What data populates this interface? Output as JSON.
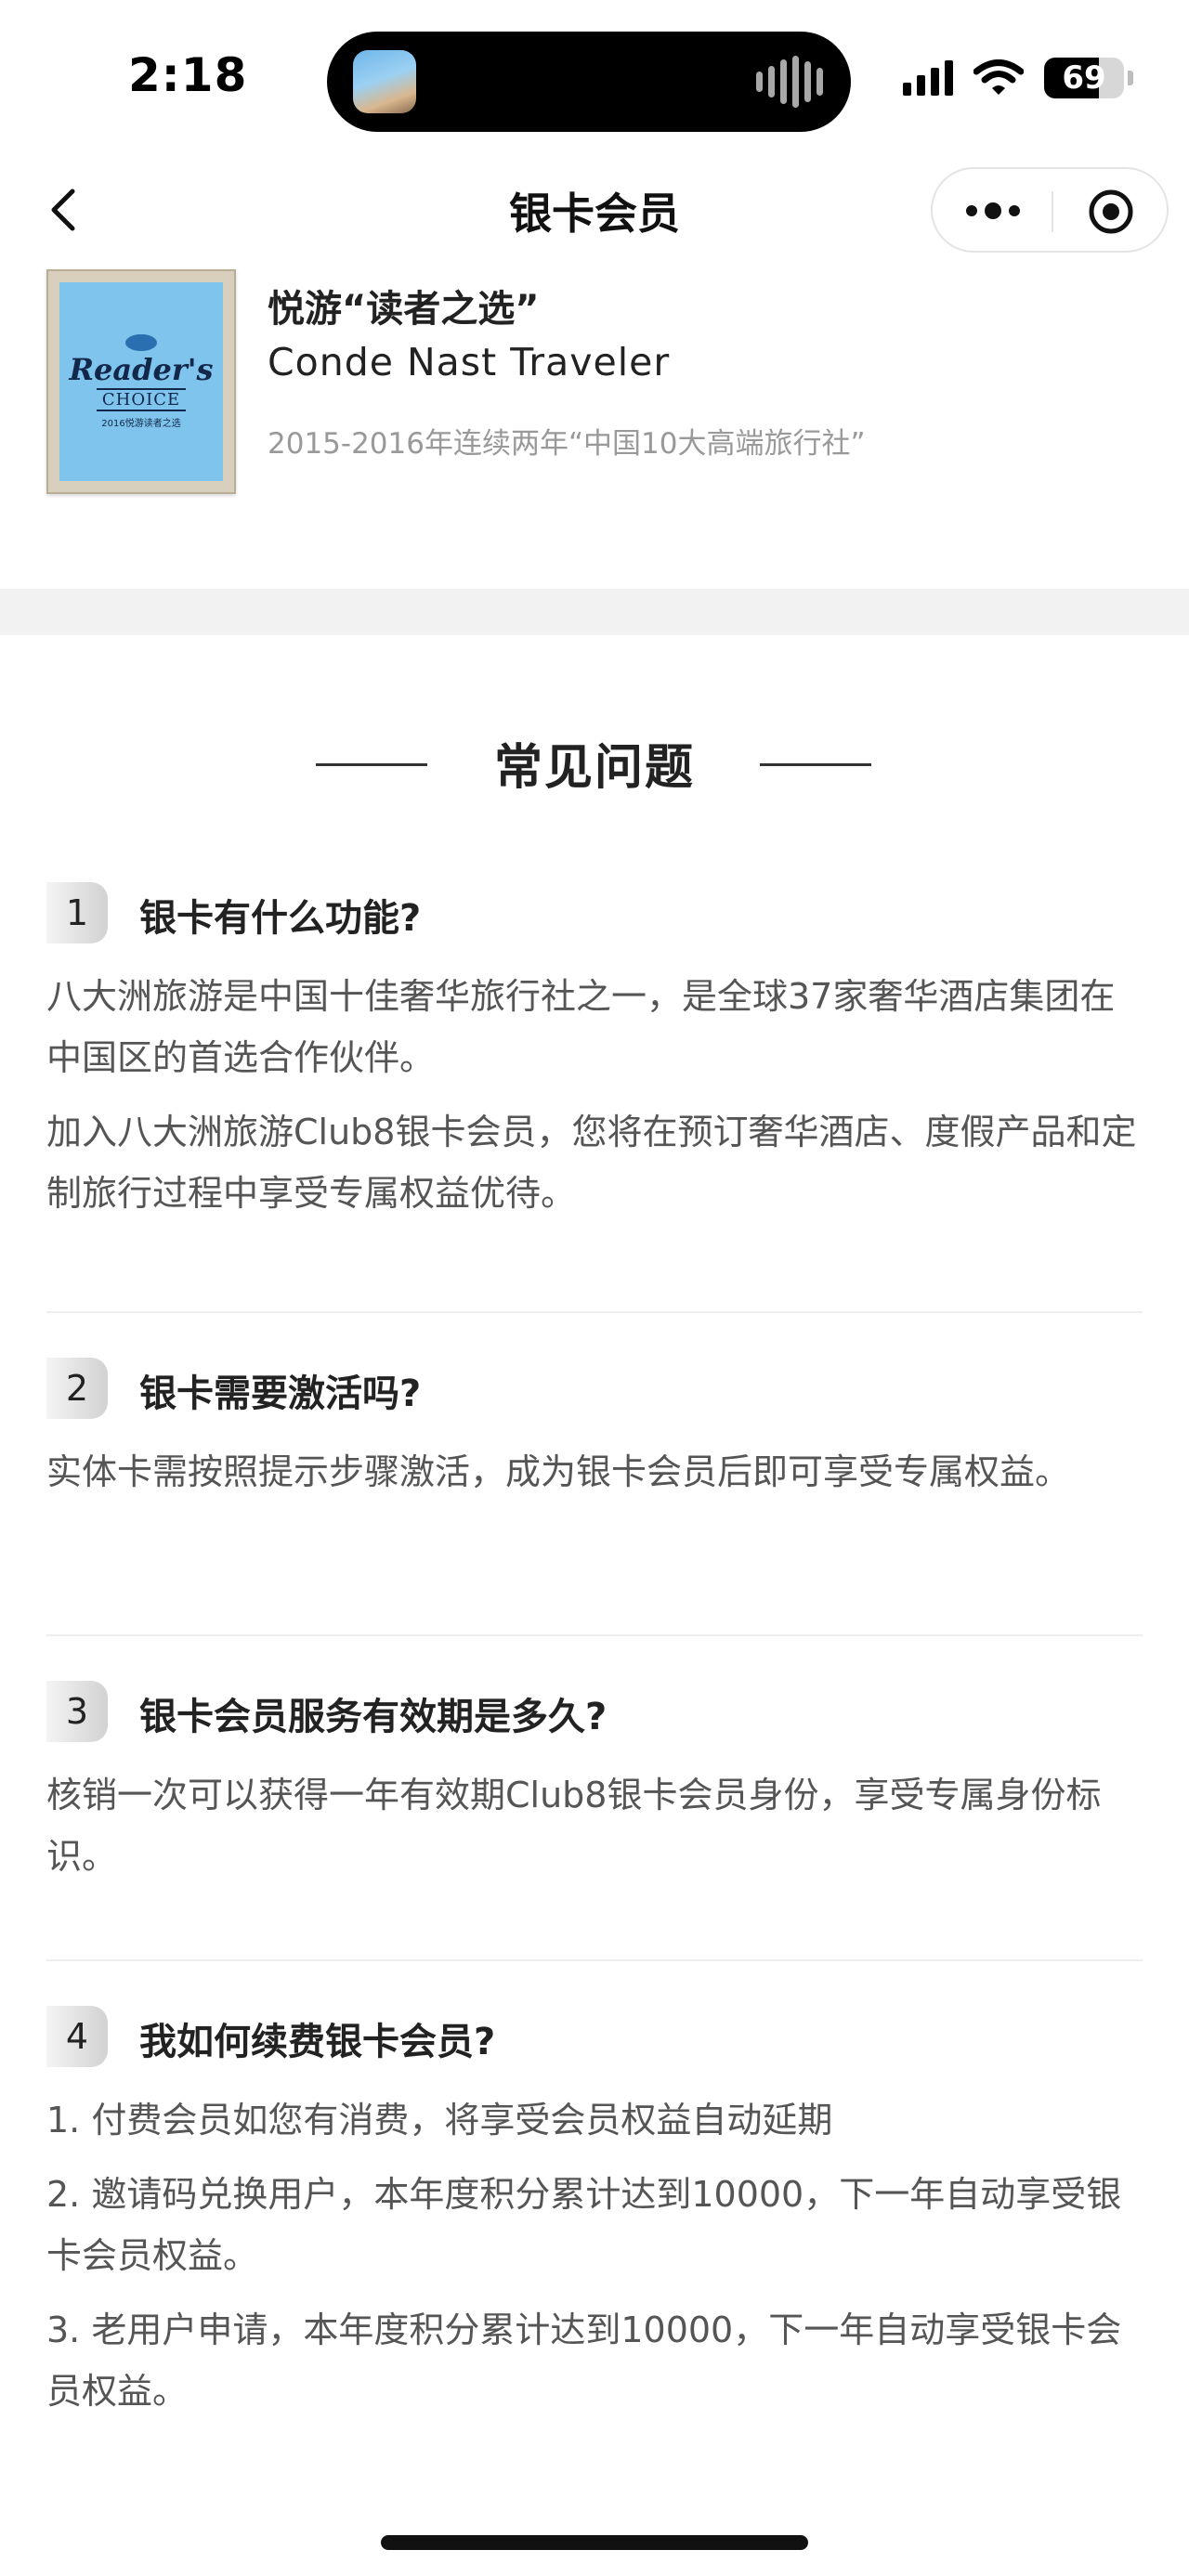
{
  "status_bar": {
    "time": "2:18",
    "battery_level": "69",
    "battery_fraction": 0.69
  },
  "nav": {
    "title": "银卡会员",
    "back_icon": "chevron-left-icon",
    "more_icon": "more-dots-icon",
    "close_icon": "target-circle-icon"
  },
  "award": {
    "title": "悦游“读者之选”",
    "publisher": "Conde Nast Traveler",
    "description": "2015-2016年连续两年“中国10大高端旅行社”",
    "plaque": {
      "main": "Reader's",
      "choice": "CHOICE",
      "sub": "2016悦游读者之选"
    }
  },
  "faq": {
    "title": "常见问题",
    "items": [
      {
        "number": "1",
        "question": "银卡有什么功能?",
        "answers": [
          "八大洲旅游是中国十佳奢华旅行社之一，是全球37家奢华酒店集团在中国区的首选合作伙伴。",
          "加入八大洲旅游Club8银卡会员，您将在预订奢华酒店、度假产品和定制旅行过程中享受专属权益优待。"
        ]
      },
      {
        "number": "2",
        "question": "银卡需要激活吗?",
        "answers": [
          "实体卡需按照提示步骤激活，成为银卡会员后即可享受专属权益。"
        ]
      },
      {
        "number": "3",
        "question": "银卡会员服务有效期是多久?",
        "answers": [
          "核销一次可以获得一年有效期Club8银卡会员身份，享受专属身份标识。"
        ]
      },
      {
        "number": "4",
        "question": "我如何续费银卡会员?",
        "answers": [
          "1. 付费会员如您有消费，将享受会员权益自动延期",
          "2. 邀请码兑换用户，本年度积分累计达到10000，下一年自动享受银卡会员权益。",
          "3. 老用户申请，本年度积分累计达到10000，下一年自动享受银卡会员权益。"
        ]
      }
    ]
  }
}
